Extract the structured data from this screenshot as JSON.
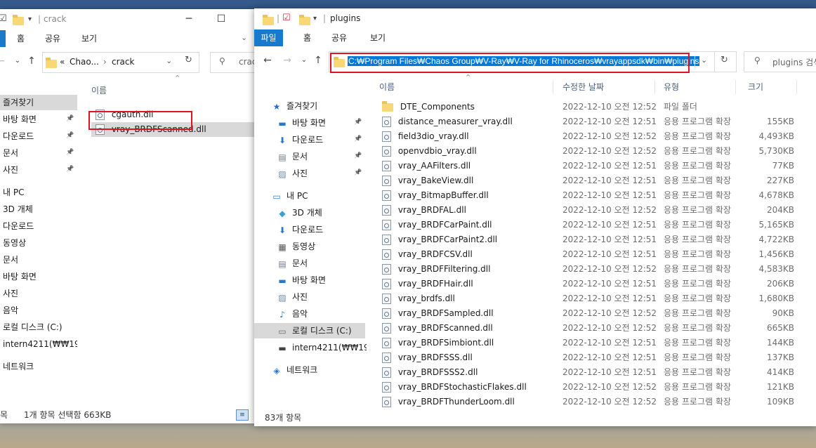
{
  "left_window": {
    "title": "crack",
    "ribbon_tabs": [
      "홈",
      "공유",
      "보기"
    ],
    "breadcrumb": {
      "prefix": "«",
      "items": [
        "Chao...",
        "crack"
      ]
    },
    "search_placeholder": "crac",
    "column_header": "이름",
    "nav_items": [
      {
        "label": "즐겨찾기"
      },
      {
        "label": "바탕 화면"
      },
      {
        "label": "다운로드"
      },
      {
        "label": "문서"
      },
      {
        "label": "사진"
      },
      {
        "label": "내 PC"
      },
      {
        "label": "3D 개체"
      },
      {
        "label": "다운로드"
      },
      {
        "label": "동영상"
      },
      {
        "label": "문서"
      },
      {
        "label": "바탕 화면"
      },
      {
        "label": "사진"
      },
      {
        "label": "음악"
      },
      {
        "label": "로컬 디스크 (C:)"
      },
      {
        "label": "intern4211(₩₩192"
      },
      {
        "label": "네트워크"
      }
    ],
    "files": [
      {
        "name": "cgauth.dll"
      },
      {
        "name": "vray_BRDFScanned.dll"
      }
    ],
    "status_prefix": "목",
    "status": "1개 항목 선택함 663KB"
  },
  "right_window": {
    "title": "plugins",
    "ribbon_tabs": [
      "파일",
      "홈",
      "공유",
      "보기"
    ],
    "address_path": "C:₩Program Files₩Chaos Group₩V-Ray₩V-Ray for Rhinoceros₩vrayappsdk₩bin₩plugins",
    "search_placeholder": "plugins 검색",
    "columns": {
      "name": "이름",
      "date": "수정한 날짜",
      "type": "유형",
      "size": "크기"
    },
    "nav_items": [
      {
        "label": "즐겨찾기",
        "icon": "star-icon"
      },
      {
        "label": "바탕 화면",
        "icon": "desktop-icon"
      },
      {
        "label": "다운로드",
        "icon": "download-icon"
      },
      {
        "label": "문서",
        "icon": "documents-icon"
      },
      {
        "label": "사진",
        "icon": "pictures-icon"
      },
      {
        "label": "내 PC",
        "icon": "pc-icon"
      },
      {
        "label": "3D 개체",
        "icon": "3d-objects-icon"
      },
      {
        "label": "다운로드",
        "icon": "download-icon"
      },
      {
        "label": "동영상",
        "icon": "videos-icon"
      },
      {
        "label": "문서",
        "icon": "documents-icon"
      },
      {
        "label": "바탕 화면",
        "icon": "desktop-icon"
      },
      {
        "label": "사진",
        "icon": "pictures-icon"
      },
      {
        "label": "음악",
        "icon": "music-icon"
      },
      {
        "label": "로컬 디스크 (C:)",
        "icon": "drive-icon"
      },
      {
        "label": "intern4211(₩₩192",
        "icon": "network-drive-icon"
      },
      {
        "label": "네트워크",
        "icon": "network-icon"
      }
    ],
    "files": [
      {
        "name": "DTE_Components",
        "date": "2022-12-10 오전 12:52",
        "type": "파일 폴더",
        "size": "",
        "kind": "folder"
      },
      {
        "name": "distance_measurer_vray.dll",
        "date": "2022-12-10 오전 12:51",
        "type": "응용 프로그램 확장",
        "size": "155KB",
        "kind": "dll"
      },
      {
        "name": "field3dio_vray.dll",
        "date": "2022-12-10 오전 12:52",
        "type": "응용 프로그램 확장",
        "size": "4,493KB",
        "kind": "dll"
      },
      {
        "name": "openvdbio_vray.dll",
        "date": "2022-12-10 오전 12:52",
        "type": "응용 프로그램 확장",
        "size": "5,730KB",
        "kind": "dll"
      },
      {
        "name": "vray_AAFilters.dll",
        "date": "2022-12-10 오전 12:51",
        "type": "응용 프로그램 확장",
        "size": "77KB",
        "kind": "dll"
      },
      {
        "name": "vray_BakeView.dll",
        "date": "2022-12-10 오전 12:51",
        "type": "응용 프로그램 확장",
        "size": "227KB",
        "kind": "dll"
      },
      {
        "name": "vray_BitmapBuffer.dll",
        "date": "2022-12-10 오전 12:51",
        "type": "응용 프로그램 확장",
        "size": "4,678KB",
        "kind": "dll"
      },
      {
        "name": "vray_BRDFAL.dll",
        "date": "2022-12-10 오전 12:52",
        "type": "응용 프로그램 확장",
        "size": "204KB",
        "kind": "dll"
      },
      {
        "name": "vray_BRDFCarPaint.dll",
        "date": "2022-12-10 오전 12:51",
        "type": "응용 프로그램 확장",
        "size": "5,165KB",
        "kind": "dll"
      },
      {
        "name": "vray_BRDFCarPaint2.dll",
        "date": "2022-12-10 오전 12:51",
        "type": "응용 프로그램 확장",
        "size": "4,722KB",
        "kind": "dll"
      },
      {
        "name": "vray_BRDFCSV.dll",
        "date": "2022-12-10 오전 12:51",
        "type": "응용 프로그램 확장",
        "size": "1,456KB",
        "kind": "dll"
      },
      {
        "name": "vray_BRDFFiltering.dll",
        "date": "2022-12-10 오전 12:52",
        "type": "응용 프로그램 확장",
        "size": "4,583KB",
        "kind": "dll"
      },
      {
        "name": "vray_BRDFHair.dll",
        "date": "2022-12-10 오전 12:51",
        "type": "응용 프로그램 확장",
        "size": "206KB",
        "kind": "dll"
      },
      {
        "name": "vray_brdfs.dll",
        "date": "2022-12-10 오전 12:51",
        "type": "응용 프로그램 확장",
        "size": "1,680KB",
        "kind": "dll"
      },
      {
        "name": "vray_BRDFSampled.dll",
        "date": "2022-12-10 오전 12:52",
        "type": "응용 프로그램 확장",
        "size": "90KB",
        "kind": "dll"
      },
      {
        "name": "vray_BRDFScanned.dll",
        "date": "2022-12-10 오전 12:52",
        "type": "응용 프로그램 확장",
        "size": "665KB",
        "kind": "dll"
      },
      {
        "name": "vray_BRDFSimbiont.dll",
        "date": "2022-12-10 오전 12:51",
        "type": "응용 프로그램 확장",
        "size": "144KB",
        "kind": "dll"
      },
      {
        "name": "vray_BRDFSSS.dll",
        "date": "2022-12-10 오전 12:51",
        "type": "응용 프로그램 확장",
        "size": "137KB",
        "kind": "dll"
      },
      {
        "name": "vray_BRDFSSS2.dll",
        "date": "2022-12-10 오전 12:51",
        "type": "응용 프로그램 확장",
        "size": "414KB",
        "kind": "dll"
      },
      {
        "name": "vray_BRDFStochasticFlakes.dll",
        "date": "2022-12-10 오전 12:52",
        "type": "응용 프로그램 확장",
        "size": "121KB",
        "kind": "dll"
      },
      {
        "name": "vray_BRDFThunderLoom.dll",
        "date": "2022-12-10 오전 12:52",
        "type": "응용 프로그램 확장",
        "size": "109KB",
        "kind": "dll"
      }
    ],
    "status": "83개 항목"
  },
  "colors": {
    "accent": "#1979ca",
    "highlight_box": "#e0141e",
    "selection": "#0078d7"
  }
}
